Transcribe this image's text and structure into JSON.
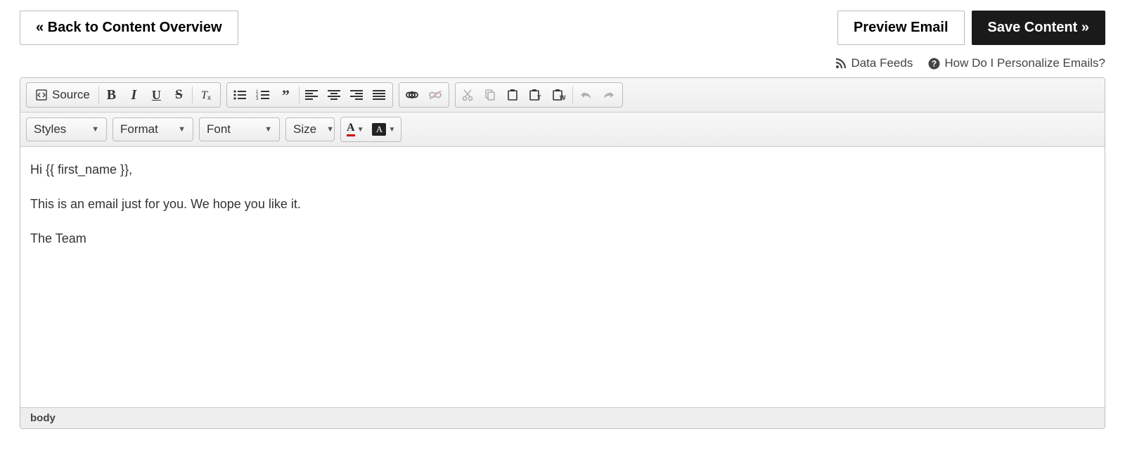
{
  "header": {
    "back_label": "« Back to Content Overview",
    "preview_label": "Preview Email",
    "save_label": "Save Content »"
  },
  "helper": {
    "data_feeds": "Data Feeds",
    "personalize": "How Do I Personalize Emails?"
  },
  "toolbar": {
    "source_label": "Source",
    "styles_label": "Styles",
    "format_label": "Format",
    "font_label": "Font",
    "size_label": "Size"
  },
  "body": {
    "line1": "Hi {{ first_name }},",
    "line2": "This is an email just for you. We hope you like it.",
    "line3": "The Team"
  },
  "status": {
    "path": "body"
  }
}
